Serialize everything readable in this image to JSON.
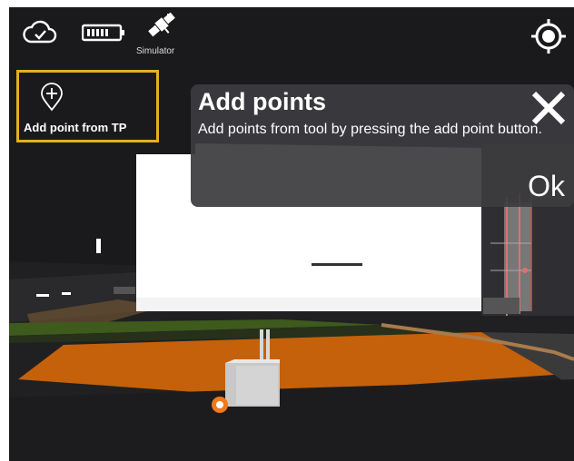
{
  "status_bar": {
    "simulator_label": "Simulator"
  },
  "add_point_tool": {
    "label": "Add point from TP"
  },
  "dialog": {
    "title": "Add points",
    "body": "Add points from tool by pressing the add point button.",
    "ok_label": "Ok"
  },
  "colors": {
    "highlight_border": "#e5b020",
    "dialog_bg": "#3c3c40",
    "ground_orange": "#c4610a",
    "ground_green": "#3e5a1c"
  }
}
